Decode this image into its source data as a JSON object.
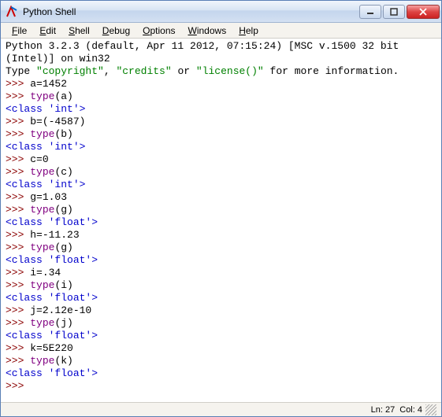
{
  "titlebar": {
    "title": "Python Shell"
  },
  "menu": {
    "file": "File",
    "edit": "Edit",
    "shell": "Shell",
    "debug": "Debug",
    "options": "Options",
    "windows": "Windows",
    "help": "Help"
  },
  "banner": {
    "line1": "Python 3.2.3 (default, Apr 11 2012, 07:15:24) [MSC v.1500 32 bit (Intel)] on win32",
    "line2a": "Type ",
    "line2b": "\"copyright\"",
    "line2c": ", ",
    "line2d": "\"credits\"",
    "line2e": " or ",
    "line2f": "\"license()\"",
    "line2g": " for more information."
  },
  "prompt": ">>>",
  "sp": " ",
  "session": {
    "a_assign": "a=1452",
    "type_a_kw": "type",
    "type_a_arg": "(a)",
    "type_a_out": "<class 'int'>",
    "b_assign": "b=(-4587)",
    "type_b_kw": "type",
    "type_b_arg": "(b)",
    "type_b_out": "<class 'int'>",
    "c_assign": "c=0",
    "type_c_kw": "type",
    "type_c_arg": "(c)",
    "type_c_out": "<class 'int'>",
    "g_assign": "g=1.03",
    "type_g_kw": "type",
    "type_g_arg": "(g)",
    "type_g_out": "<class 'float'>",
    "h_assign": "h=-11.23",
    "type_g2_kw": "type",
    "type_g2_arg": "(g)",
    "type_g2_out": "<class 'float'>",
    "i_assign": "i=.34",
    "type_i_kw": "type",
    "type_i_arg": "(i)",
    "type_i_out": "<class 'float'>",
    "j_assign": "j=2.12e-10",
    "type_j_kw": "type",
    "type_j_arg": "(j)",
    "type_j_out": "<class 'float'>",
    "k_assign": "k=5E220",
    "type_k_kw": "type",
    "type_k_arg": "(k)",
    "type_k_out": "<class 'float'>"
  },
  "status": {
    "ln": "Ln: 27",
    "col": "Col: 4"
  }
}
